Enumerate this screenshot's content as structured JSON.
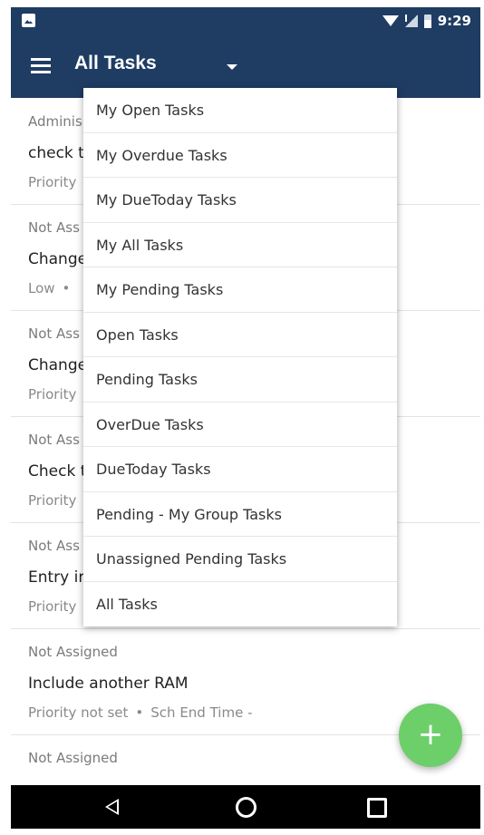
{
  "status_bar": {
    "time": "9:29"
  },
  "app_bar": {
    "title": "All Tasks"
  },
  "tasks": [
    {
      "assignee": "Adminis",
      "name": "check t",
      "meta1": "Priority",
      "meta2": ""
    },
    {
      "assignee": "Not Ass",
      "name": "Change",
      "meta1": "Low",
      "meta2": ""
    },
    {
      "assignee": "Not Ass",
      "name": "Change",
      "meta1": "Priority",
      "meta2": ""
    },
    {
      "assignee": "Not Ass",
      "name": "Check t",
      "meta1": "Priority",
      "meta2": ""
    },
    {
      "assignee": "Not Ass",
      "name": "Entry ir",
      "meta1": "Priority",
      "meta2": ""
    },
    {
      "assignee": "Not Assigned",
      "name": "Include another RAM",
      "meta1": "Priority not set",
      "meta2": "Sch End Time -"
    },
    {
      "assignee": "Not Assigned",
      "name": "",
      "meta1": "",
      "meta2": ""
    }
  ],
  "dropdown": {
    "items": [
      "My Open Tasks",
      "My Overdue Tasks",
      "My DueToday Tasks",
      "My All Tasks",
      "My Pending Tasks",
      "Open Tasks",
      "Pending Tasks",
      "OverDue Tasks",
      "DueToday Tasks",
      "Pending - My Group Tasks",
      "Unassigned Pending Tasks",
      "All Tasks"
    ]
  },
  "fab": {
    "symbol": "+"
  },
  "colors": {
    "primary": "#1f3c63",
    "fab": "#6ccf6a"
  }
}
